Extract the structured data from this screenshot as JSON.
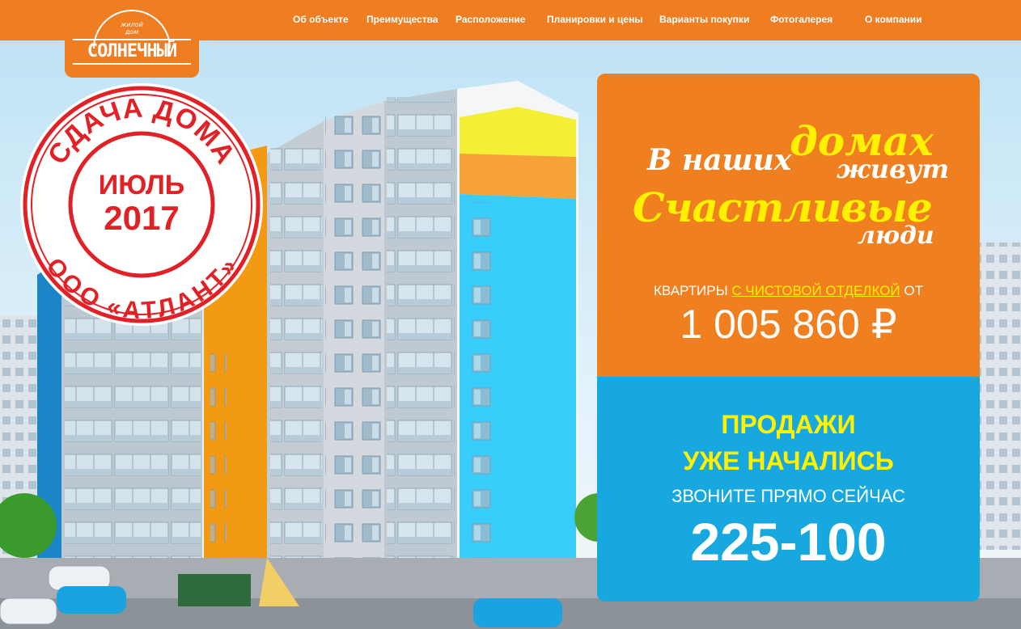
{
  "brand": {
    "subtitle_line1": "жилой",
    "subtitle_line2": "дом",
    "name": "СОЛНЕЧНЫЙ"
  },
  "nav": {
    "items": [
      {
        "label": "Об объекте"
      },
      {
        "label": "Преимущества"
      },
      {
        "label": "Расположение"
      },
      {
        "label": "Планировки и цены"
      },
      {
        "label": "Варианты покупки"
      },
      {
        "label": "Фотогалерея"
      },
      {
        "label": "О компании"
      }
    ]
  },
  "stamp": {
    "top_arc": "СДАЧА ДОМА",
    "month": "ИЮЛЬ",
    "year": "2017",
    "bottom_arc": "ООО «АТЛАНТ»"
  },
  "promo": {
    "slogan": {
      "w1": "В наших",
      "w2": "домах",
      "w3": "живут",
      "w4": "Счастливые",
      "w5": "люди"
    },
    "apartments_prefix": "КВАРТИРЫ",
    "apartments_link": "С ЧИСТОВОЙ ОТДЕЛКОЙ",
    "apartments_suffix": "ОТ",
    "price": "1 005 860 ₽",
    "sales_line1": "ПРОДАЖИ",
    "sales_line2": "УЖЕ НАЧАЛИСЬ",
    "call_text": "ЗВОНИТЕ ПРЯМО СЕЙЧАС",
    "phone": "225-100"
  },
  "colors": {
    "brand_orange": "#ef7d22",
    "promo_blue": "#17a8df",
    "accent_yellow": "#fff100",
    "stamp_red": "#e22126"
  }
}
